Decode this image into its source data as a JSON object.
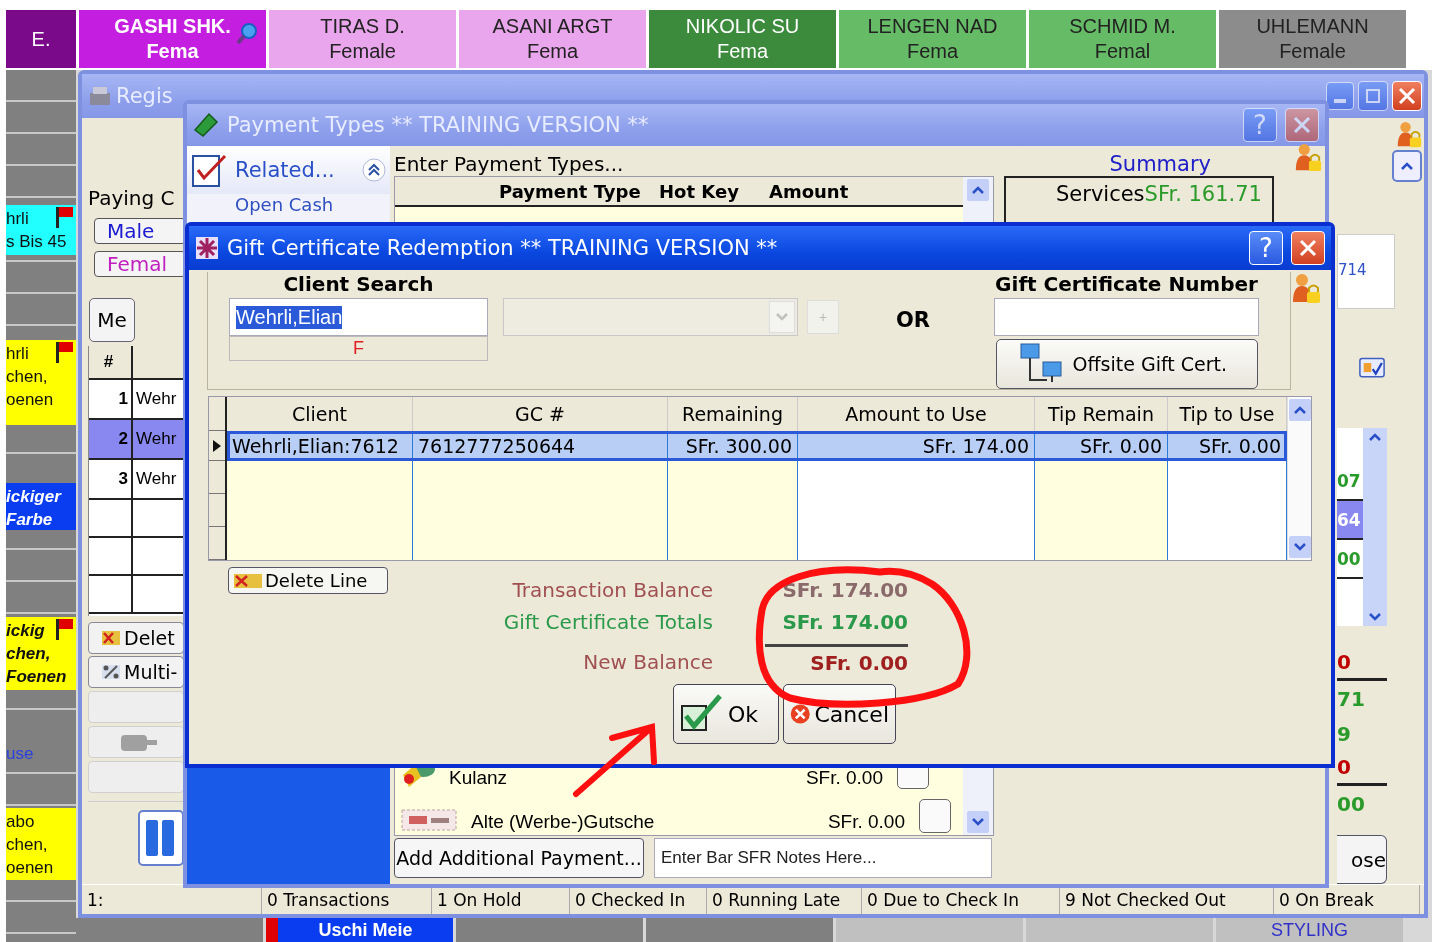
{
  "staff_columns": [
    {
      "name": "E.",
      "color": "#7a0a8a",
      "selected": false
    },
    {
      "name": "GASHI SHK.",
      "gender": "Fema",
      "color": "#c41ee0",
      "selected": true
    },
    {
      "name": "TIRAS D.",
      "gender": "Female",
      "color": "#eaa6ec",
      "selected": false
    },
    {
      "name": "ASANI ARGT",
      "gender": "Fema",
      "color": "#eaa6ec",
      "selected": false
    },
    {
      "name": "NIKOLIC SU",
      "gender": "Fema",
      "color": "#3c8a3c",
      "selected": false
    },
    {
      "name": "LENGEN NAD",
      "gender": "Fema",
      "color": "#66bb66",
      "selected": false
    },
    {
      "name": "SCHMID M.",
      "gender": "Femal",
      "color": "#66bb66",
      "selected": false
    },
    {
      "name": "UHLEMANN",
      "gender": "Female",
      "color": "#8c8c8c",
      "selected": false
    }
  ],
  "schedule_blocks": [
    {
      "lines": [
        "hrli",
        "s Bis 45"
      ],
      "color": "#22ffff",
      "flag": true,
      "italic": false,
      "link": false
    },
    {
      "lines": [
        "hrli",
        "chen,",
        "oenen"
      ],
      "color": "#ffff00",
      "flag": true,
      "italic": false,
      "link": false
    },
    {
      "lines": [
        "ickiger",
        "Farbe"
      ],
      "color": "#0a3cf0",
      "flag": false,
      "italic": true,
      "link": false
    },
    {
      "lines": [
        "ickig",
        "chen,",
        "Foenen"
      ],
      "color": "#ffff00",
      "flag": true,
      "italic": true,
      "link": false
    },
    {
      "lines": [
        "use"
      ],
      "color": "#808080",
      "flag": false,
      "italic": false,
      "link": true
    },
    {
      "lines": [
        "abo",
        "chen,",
        "oenen"
      ],
      "color": "#ffff00",
      "flag": false,
      "italic": false,
      "link": false
    }
  ],
  "bottom_row": [
    {
      "color": "#808080"
    },
    {
      "text": "Uschi Meie",
      "color": "#0a3cf0"
    },
    {
      "color": "#808080"
    },
    {
      "color": "#808080"
    },
    {
      "color": "#c0c0c0"
    },
    {
      "color": "#c0c0c0"
    },
    {
      "text": "STYLING",
      "color": "#c0c0c0"
    }
  ],
  "register": {
    "title": "Regis",
    "paying_label": "Paying C",
    "gender_buttons": [
      {
        "label": "Male",
        "color": "#1a1ad0"
      },
      {
        "label": "Femal",
        "color": "#c020c0"
      }
    ],
    "me_button": "Me",
    "grid": {
      "header": "#",
      "rows": [
        {
          "number": "1",
          "client": "Wehr",
          "selected": false
        },
        {
          "number": "2",
          "client": "Wehr",
          "selected": true
        },
        {
          "number": "3",
          "client": "Wehr",
          "selected": false
        }
      ]
    },
    "action_buttons": [
      {
        "label": "Delet",
        "kind": "delete"
      },
      {
        "label": "Multi-",
        "kind": "multi"
      }
    ],
    "code_fragment": "714",
    "right_grid": [
      {
        "text": "07",
        "selected": false
      },
      {
        "text": "64",
        "selected": true
      },
      {
        "text": "00",
        "selected": false
      }
    ],
    "totals": [
      {
        "text": "0",
        "color": "#c00000"
      },
      {
        "text": "71",
        "color": "#2a9a2a"
      },
      {
        "text": "9",
        "color": "#2a9a2a"
      },
      {
        "text": "0",
        "color": "#c00000"
      },
      {
        "text": "00",
        "color": "#2a9a2a"
      }
    ],
    "close_button": "ose",
    "status_bar": [
      "1:",
      "0 Transactions",
      "1 On Hold",
      "0 Checked In",
      "0 Running Late",
      "0 Due to Check In",
      "9 Not Checked Out",
      "0 On Break"
    ]
  },
  "payment_types": {
    "title": "Payment Types ** TRAINING VERSION **",
    "help_button": "?",
    "related": {
      "title": "Related...",
      "items": [
        "Open Cash"
      ]
    },
    "heading": "Enter Payment Types...",
    "columns": [
      "Payment Type",
      "Hot Key",
      "Amount"
    ],
    "rows": [
      {
        "name": "Kulanz",
        "amount": "SFr. 0.00",
        "kind": "gesture"
      },
      {
        "name": "Alte (Werbe-)Gutsche",
        "amount": "SFr. 0.00",
        "kind": "voucher"
      }
    ],
    "summary": {
      "title": "Summary",
      "rows": [
        {
          "label": "Services",
          "value": "SFr. 161.71"
        }
      ]
    },
    "add_button": "Add Additional Payment...",
    "notes": {
      "placeholder": "Enter Bar SFR Notes Here..."
    }
  },
  "gift_certificate": {
    "title": "Gift Certificate Redemption ** TRAINING VERSION **",
    "help_button": "?",
    "client_search": {
      "label": "Client Search",
      "value": "Wehrli,Elian",
      "gender": "F"
    },
    "add_button": "+",
    "or_label": "OR",
    "certificate_number": {
      "label": "Gift Certificate Number"
    },
    "offsite_button": "Offsite Gift Cert.",
    "columns": [
      {
        "label": "Client",
        "editable": false
      },
      {
        "label": "GC #",
        "editable": false
      },
      {
        "label": "Remaining",
        "editable": false
      },
      {
        "label": "Amount to Use",
        "editable": true
      },
      {
        "label": "Tip Remain",
        "editable": false
      },
      {
        "label": "Tip to Use",
        "editable": true
      }
    ],
    "rows": [
      {
        "cells": [
          "Wehrli,Elian:7612",
          "7612777250644",
          "SFr. 300.00",
          "SFr. 174.00",
          "SFr. 0.00",
          "SFr. 0.00"
        ],
        "selected": true
      }
    ],
    "delete_button": "Delete Line",
    "totals": [
      {
        "label": "Transaction Balance",
        "value": "SFr. 174.00",
        "kind": "balance"
      },
      {
        "label": "Gift Certificate Totals",
        "value": "SFr. 174.00",
        "kind": "gift"
      },
      {
        "label": "New Balance",
        "value": "SFr. 0.00",
        "kind": "new"
      }
    ],
    "ok_button": "Ok",
    "cancel_button": "Cancel"
  }
}
